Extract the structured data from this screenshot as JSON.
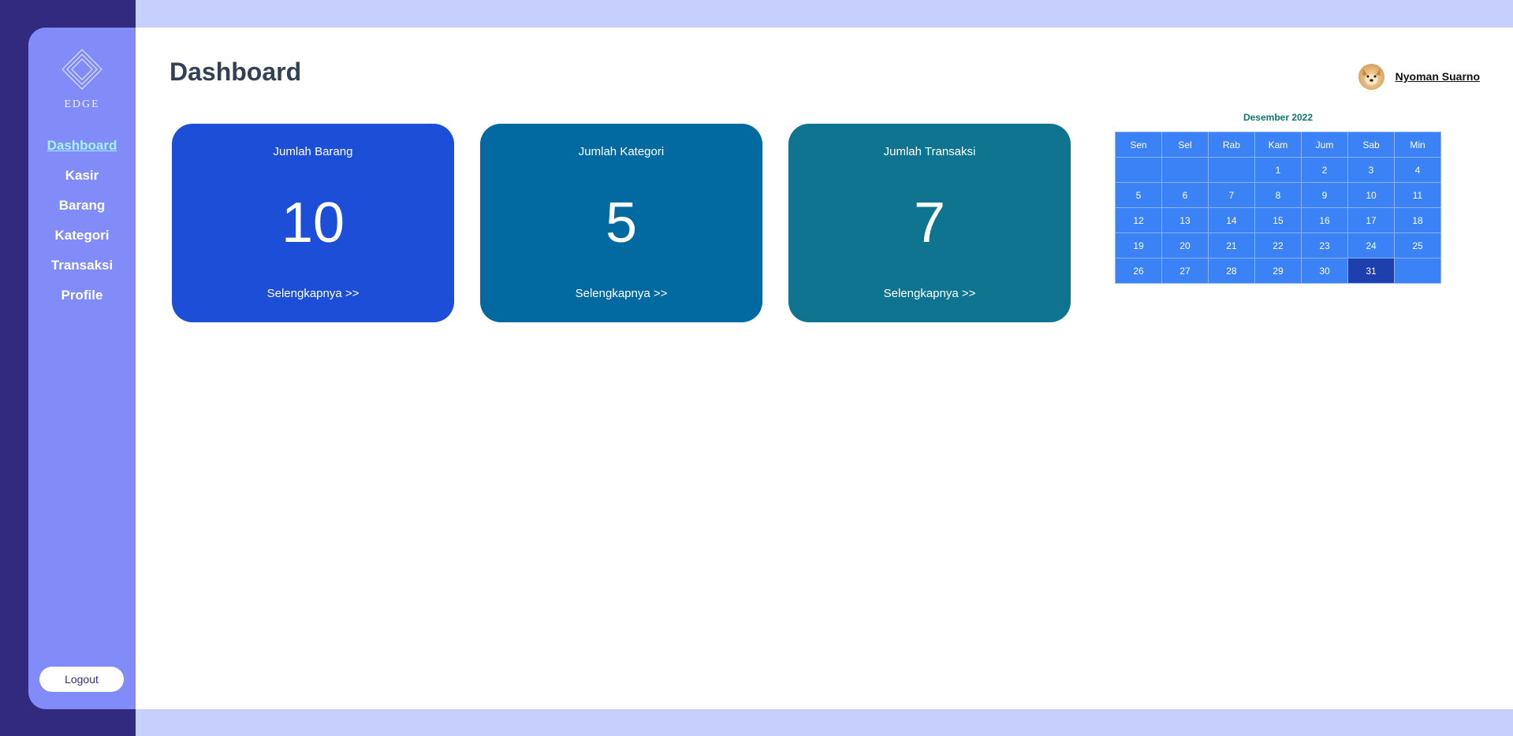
{
  "sidebar": {
    "logo_text": "EDGE",
    "items": [
      {
        "label": "Dashboard",
        "active": true
      },
      {
        "label": "Kasir",
        "active": false
      },
      {
        "label": "Barang",
        "active": false
      },
      {
        "label": "Kategori",
        "active": false
      },
      {
        "label": "Transaksi",
        "active": false
      },
      {
        "label": "Profile",
        "active": false
      }
    ],
    "logout_label": "Logout"
  },
  "header": {
    "title": "Dashboard",
    "user_name": "Nyoman Suarno",
    "avatar_icon": "dog-avatar"
  },
  "cards": [
    {
      "title": "Jumlah Barang",
      "value": "10",
      "link": "Selengkapnya >>",
      "color": "#1d4ed8"
    },
    {
      "title": "Jumlah Kategori",
      "value": "5",
      "link": "Selengkapnya >>",
      "color": "#0369a1"
    },
    {
      "title": "Jumlah Transaksi",
      "value": "7",
      "link": "Selengkapnya >>",
      "color": "#0e7490"
    }
  ],
  "calendar": {
    "caption": "Desember 2022",
    "days": [
      "Sen",
      "Sel",
      "Rab",
      "Kam",
      "Jum",
      "Sab",
      "Min"
    ],
    "weeks": [
      [
        "",
        "",
        "",
        "1",
        "2",
        "3",
        "4"
      ],
      [
        "5",
        "6",
        "7",
        "8",
        "9",
        "10",
        "11"
      ],
      [
        "12",
        "13",
        "14",
        "15",
        "16",
        "17",
        "18"
      ],
      [
        "19",
        "20",
        "21",
        "22",
        "23",
        "24",
        "25"
      ],
      [
        "26",
        "27",
        "28",
        "29",
        "30",
        "31",
        ""
      ]
    ],
    "today": "31"
  },
  "colors": {
    "sidebar_bg": "#818cf8",
    "rail_bg": "#312a7e",
    "page_bg": "#c7d0fd",
    "active_nav": "#a5f3fc",
    "calendar_cell": "#3b82f6",
    "calendar_today": "#1e40af"
  }
}
